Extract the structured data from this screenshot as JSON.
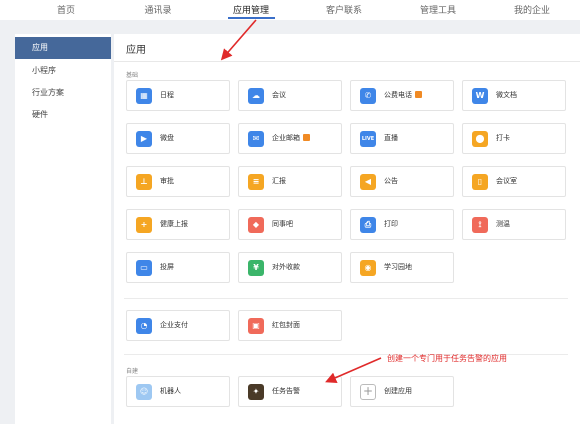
{
  "topnav": {
    "tabs": [
      "首页",
      "通讯录",
      "应用管理",
      "客户联系",
      "管理工具",
      "我的企业"
    ],
    "active_index": 2
  },
  "sidebar": {
    "items": [
      "应用",
      "小程序",
      "行业方案",
      "硬件"
    ],
    "active_index": 0
  },
  "main": {
    "title": "应用",
    "sections": [
      {
        "label": "基础",
        "apps": [
          {
            "label": "日程",
            "icon": "calendar-icon",
            "color": "#3f86e8",
            "glyph": "▦"
          },
          {
            "label": "会议",
            "icon": "cloud-icon",
            "color": "#3f86e8",
            "glyph": "☁"
          },
          {
            "label": "公费电话",
            "icon": "phone-icon",
            "color": "#3f86e8",
            "glyph": "✆",
            "badge": true
          },
          {
            "label": "微文档",
            "icon": "w-doc-icon",
            "color": "#3f86e8",
            "glyph": "W"
          },
          {
            "label": "微盘",
            "icon": "drive-icon",
            "color": "#3f86e8",
            "glyph": "▶"
          },
          {
            "label": "企业邮箱",
            "icon": "mail-icon",
            "color": "#3f86e8",
            "glyph": "✉",
            "badge": true
          },
          {
            "label": "直播",
            "icon": "live-icon",
            "color": "#3f86e8",
            "glyph": "LIVE"
          },
          {
            "label": "打卡",
            "icon": "location-pin-icon",
            "color": "#f5a623",
            "glyph": "⬤"
          },
          {
            "label": "审批",
            "icon": "stamp-icon",
            "color": "#f5a623",
            "glyph": "⊥"
          },
          {
            "label": "汇报",
            "icon": "report-icon",
            "color": "#f5a623",
            "glyph": "≡"
          },
          {
            "label": "公告",
            "icon": "megaphone-icon",
            "color": "#f5a623",
            "glyph": "◀"
          },
          {
            "label": "会议室",
            "icon": "door-icon",
            "color": "#f5a623",
            "glyph": "▯"
          },
          {
            "label": "健康上报",
            "icon": "health-report-icon",
            "color": "#f5a623",
            "glyph": "+"
          },
          {
            "label": "同事吧",
            "icon": "colleague-icon",
            "color": "#f06a5a",
            "glyph": "◆"
          },
          {
            "label": "打印",
            "icon": "printer-icon",
            "color": "#3f86e8",
            "glyph": "⎙"
          },
          {
            "label": "测温",
            "icon": "thermometer-icon",
            "color": "#f06a5a",
            "glyph": "⟟"
          },
          {
            "label": "投屏",
            "icon": "cast-icon",
            "color": "#3f86e8",
            "glyph": "▭"
          },
          {
            "label": "对外收款",
            "icon": "payment-icon",
            "color": "#3bb56a",
            "glyph": "¥"
          },
          {
            "label": "学习园地",
            "icon": "planet-icon",
            "color": "#f5a623",
            "glyph": "◉"
          }
        ]
      },
      {
        "label": "",
        "apps": [
          {
            "label": "企业支付",
            "icon": "pay-icon",
            "color": "#3f86e8",
            "glyph": "◔"
          },
          {
            "label": "红包封面",
            "icon": "red-envelope-icon",
            "color": "#f06a5a",
            "glyph": "▣"
          }
        ]
      },
      {
        "label": "自建",
        "apps": [
          {
            "label": "机器人",
            "icon": "robot-icon",
            "color": "#9ec8f2",
            "glyph": "☺"
          },
          {
            "label": "任务告警",
            "icon": "task-alert-icon",
            "color": "#4a3a28",
            "glyph": "✦"
          },
          {
            "label": "创建应用",
            "icon": "plus-icon",
            "color": "#ffffff",
            "glyph": "+",
            "create": true
          }
        ]
      }
    ]
  },
  "annotation": "创建一个专门用于任务告警的应用"
}
